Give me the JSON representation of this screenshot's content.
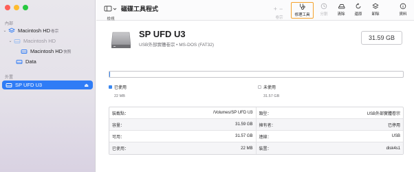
{
  "window_controls": [
    "close",
    "minimize",
    "zoom"
  ],
  "sidebar": {
    "internal_label": "內部",
    "external_label": "外置",
    "items": [
      {
        "label": "Macintosh HD",
        "sublabel": "卷宗",
        "icon": "layers-icon"
      },
      {
        "label": "Macintosh HD",
        "icon": "disk-icon"
      },
      {
        "label": "Macintosh HD",
        "sublabel": "快照",
        "icon": "disk-icon"
      },
      {
        "label": "Data",
        "icon": "disk-icon"
      },
      {
        "label": "SP UFD U3",
        "icon": "disk-icon",
        "selected": true
      }
    ]
  },
  "toolbar": {
    "view_label": "檢視",
    "title": "磁碟工具程式",
    "plus_minus_label": "卷宗",
    "buttons": [
      {
        "label": "修理工具",
        "icon": "stethoscope-icon",
        "state": "active"
      },
      {
        "label": "分割",
        "icon": "partition-icon",
        "state": "disabled"
      },
      {
        "label": "清除",
        "icon": "erase-icon",
        "state": "enabled"
      },
      {
        "label": "還原",
        "icon": "restore-icon",
        "state": "enabled"
      },
      {
        "label": "卸除",
        "icon": "unmount-icon",
        "state": "enabled"
      },
      {
        "label": "資料",
        "icon": "info-icon",
        "state": "enabled"
      }
    ]
  },
  "disk": {
    "name": "SP UFD U3",
    "subtitle": "USB外部實體卷宗 • MS-DOS (FAT32)",
    "capacity": "31.59 GB"
  },
  "usage": {
    "used_fraction": 0.0007,
    "used_label": "已使用",
    "used_value": "22 MB",
    "free_label": "未使用",
    "free_value": "31.57 GB",
    "used_color": "#3a87f0"
  },
  "info_table": [
    {
      "lk": "裝載點：",
      "lv": "/Volumes/SP UFD U3",
      "rk": "類型：",
      "rv": "USB外部實體卷宗"
    },
    {
      "lk": "容量：",
      "lv": "31.59 GB",
      "rk": "擁有者：",
      "rv": "已停用"
    },
    {
      "lk": "可用：",
      "lv": "31.57 GB",
      "rk": "連線：",
      "rv": "USB"
    },
    {
      "lk": "已使用：",
      "lv": "22 MB",
      "rk": "裝置：",
      "rv": "disk4s1"
    }
  ],
  "colors": {
    "accent": "#2f7cf6",
    "highlight_border": "#f5a12a"
  }
}
